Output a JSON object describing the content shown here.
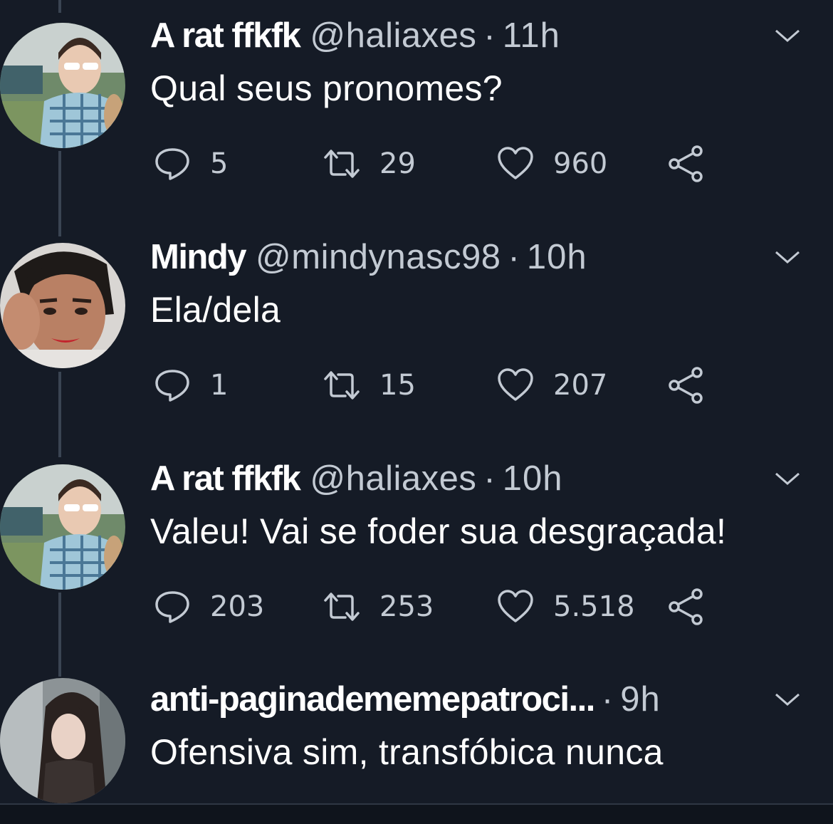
{
  "colors": {
    "background": "#151b26",
    "text_primary": "#ffffff",
    "text_secondary": "#c3cad3",
    "thread_line": "#3a4452"
  },
  "icons": {
    "reply": "reply-icon",
    "retweet": "retweet-icon",
    "like": "heart-icon",
    "share": "share-icon",
    "menu": "chevron-down-icon"
  },
  "tweets": [
    {
      "name": "A rat ffkfk",
      "handle": "@haliaxes",
      "separator": "·",
      "time": "11h",
      "text": "Qual seus pronomes?",
      "replies": "5",
      "retweets": "29",
      "likes": "960"
    },
    {
      "name": "Mindy",
      "handle": "@mindynasc98",
      "separator": "·",
      "time": "10h",
      "text": "Ela/dela",
      "replies": "1",
      "retweets": "15",
      "likes": "207"
    },
    {
      "name": "A rat ffkfk",
      "handle": "@haliaxes",
      "separator": "·",
      "time": "10h",
      "text": "Valeu! Vai se foder sua desgraçada!",
      "replies": "203",
      "retweets": "253",
      "likes": "5.518"
    },
    {
      "name": "anti-paginadememepatroci...",
      "handle": "",
      "separator": "·",
      "time": "9h",
      "text": "Ofensiva sim, transfóbica nunca"
    }
  ]
}
